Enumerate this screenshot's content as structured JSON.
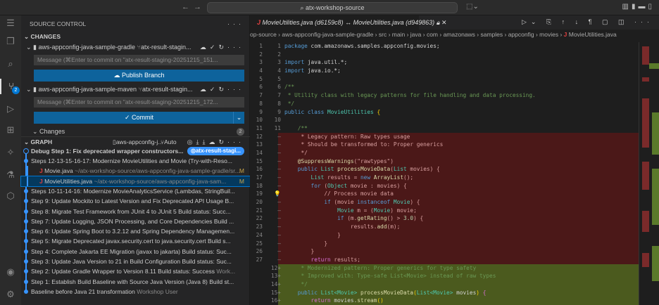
{
  "titlebar": {
    "search": "atx-workshop-source"
  },
  "activity": {
    "scm_badge": "2"
  },
  "sidebar": {
    "title": "SOURCE CONTROL",
    "changes_header": "CHANGES",
    "repos": [
      {
        "name": "aws-appconfig-java-sample-gradle",
        "branch": "atx-result-stagin...",
        "placeholder": "Message (⌘Enter to commit on \"atx-result-staging-20251215_151...",
        "button": "Publish Branch"
      },
      {
        "name": "aws-appconfig-java-sample-maven",
        "branch": "atx-result-stagin...",
        "placeholder": "Message (⌘Enter to commit on \"atx-result-staging-20251215_172...",
        "button": "Commit"
      }
    ],
    "changes_label": "Changes",
    "changes_count": "2",
    "graph": {
      "header": "GRAPH",
      "repo": "aws-appconfig-j...",
      "mode": "Auto",
      "head": {
        "message": "Debug Step 1: Fix deprecated wrapper constructors...",
        "branch": "atx-result-stagi..."
      },
      "commits": [
        {
          "message": "Steps 12-13-15-16-17: Modernize MovieUtilities and Movie (Try-with-Reso...",
          "author": ""
        },
        {
          "file": "Movie.java",
          "path": "~/atx-workshop-source/aws-appconfig-java-sample-gradle/sr...",
          "status": "M"
        },
        {
          "file": "MovieUtilities.java",
          "path": "~/atx-workshop-source/aws-appconfig-java-sam...",
          "status": "M"
        },
        {
          "message": "Steps 10-11-14-16: Modernize MovieAnalyticsService (Lambdas, StringBuil...",
          "author": ""
        },
        {
          "message": "Step 9: Update Mockito to Latest Version and Fix Deprecated API Usage B...",
          "author": ""
        },
        {
          "message": "Step 8: Migrate Test Framework from JUnit 4 to JUnit 5 Build status: Succ...",
          "author": ""
        },
        {
          "message": "Step 7: Update Logging, JSON Processing, and Core Dependencies Build ...",
          "author": ""
        },
        {
          "message": "Step 6: Update Spring Boot to 3.2.12 and Spring Dependency Managemen...",
          "author": ""
        },
        {
          "message": "Step 5: Migrate Deprecated javax.security.cert to java.security.cert Build s...",
          "author": ""
        },
        {
          "message": "Step 4: Complete Jakarta EE Migration (javax to jakarta) Build status: Suc...",
          "author": ""
        },
        {
          "message": "Step 3: Update Java Version to 21 in Build Configuration Build status: Suc...",
          "author": ""
        },
        {
          "message": "Step 2: Update Gradle Wrapper to Version 8.11 Build status: Success",
          "author": "Work..."
        },
        {
          "message": "Step 1: Establish Build Baseline with Source Java Version (Java 8) Build st...",
          "author": ""
        },
        {
          "message": "Baseline before Java 21 transformation",
          "author": "Workshop User"
        }
      ]
    }
  },
  "editor": {
    "tab": "MovieUtilities.java (d6159c8) ↔ MovieUtilities.java (d949863)",
    "breadcrumb": [
      "op-source",
      "aws-appconfig-java-sample-gradle",
      "src",
      "main",
      "java",
      "com",
      "amazonaws",
      "samples",
      "appconfig",
      "movies",
      "MovieUtilities.java"
    ],
    "lines": [
      {
        "o": "1",
        "n": "1",
        "k": "",
        "t": [
          [
            "kw",
            "package"
          ],
          [
            "pl",
            " com.amazonaws.samples.appconfig.movies;"
          ]
        ]
      },
      {
        "o": "2",
        "n": "2",
        "k": "",
        "t": []
      },
      {
        "o": "3",
        "n": "3",
        "k": "",
        "t": [
          [
            "kw",
            "import"
          ],
          [
            "pl",
            " java.util.*;"
          ]
        ]
      },
      {
        "o": "4",
        "n": "4",
        "k": "",
        "t": [
          [
            "kw",
            "import"
          ],
          [
            "pl",
            " java.io.*;"
          ]
        ]
      },
      {
        "o": "5",
        "n": "5",
        "k": "",
        "t": []
      },
      {
        "o": "6",
        "n": "6",
        "k": "",
        "t": [
          [
            "cm",
            "/**"
          ]
        ]
      },
      {
        "o": "7",
        "n": "7",
        "k": "",
        "t": [
          [
            "cm",
            " * Utility class with legacy patterns for file handling and data processing."
          ]
        ]
      },
      {
        "o": "8",
        "n": "8",
        "k": "",
        "t": [
          [
            "cm",
            " */"
          ]
        ]
      },
      {
        "o": "9",
        "n": "9",
        "k": "",
        "t": [
          [
            "kw",
            "public class "
          ],
          [
            "ty",
            "MovieUtilities"
          ],
          [
            "br",
            " {"
          ]
        ]
      },
      {
        "o": "10",
        "n": "10",
        "k": "",
        "t": []
      },
      {
        "o": "11",
        "n": "11",
        "k": "",
        "t": [
          [
            "cm",
            "    /**"
          ]
        ]
      },
      {
        "o": "12",
        "n": "—",
        "k": "del",
        "t": [
          [
            "cm",
            "     * Legacy pattern: Raw types usage"
          ]
        ]
      },
      {
        "o": "13",
        "n": "—",
        "k": "del",
        "t": [
          [
            "cm",
            "     * Should be transformed to: Proper generics"
          ]
        ]
      },
      {
        "o": "14",
        "n": "—",
        "k": "del",
        "t": [
          [
            "cm",
            "     */"
          ]
        ]
      },
      {
        "o": "15",
        "n": "—",
        "k": "del",
        "t": [
          [
            "fn",
            "    @SuppressWarnings"
          ],
          [
            "pl",
            "("
          ],
          [
            "st",
            "\"rawtypes\""
          ],
          [
            "pl",
            ")"
          ]
        ]
      },
      {
        "o": "16",
        "n": "—",
        "k": "del",
        "t": [
          [
            "kw",
            "    public "
          ],
          [
            "ty",
            "List"
          ],
          [
            "fn",
            " processMovieData"
          ],
          [
            "pl",
            "("
          ],
          [
            "ty",
            "List"
          ],
          [
            "pl",
            " movies) {"
          ]
        ]
      },
      {
        "o": "17",
        "n": "—",
        "k": "del",
        "t": [
          [
            "ty",
            "        List"
          ],
          [
            "pl",
            " results = "
          ],
          [
            "kw",
            "new"
          ],
          [
            "fn",
            " ArrayList"
          ],
          [
            "pl",
            "();"
          ]
        ]
      },
      {
        "o": "18",
        "n": "—",
        "k": "del",
        "t": [
          [
            "kw",
            "        for"
          ],
          [
            "pl",
            " ("
          ],
          [
            "ty",
            "Object"
          ],
          [
            "pl",
            " movie : movies) {"
          ]
        ]
      },
      {
        "o": "19",
        "n": "💡",
        "k": "del",
        "t": [
          [
            "cm",
            "            // Process movie data"
          ]
        ]
      },
      {
        "o": "20",
        "n": "—",
        "k": "del",
        "t": [
          [
            "kw",
            "            if"
          ],
          [
            "pl",
            " (movie "
          ],
          [
            "kw",
            "instanceof"
          ],
          [
            "ty",
            " Movie"
          ],
          [
            "pl",
            ") {"
          ]
        ]
      },
      {
        "o": "21",
        "n": "—",
        "k": "del",
        "t": [
          [
            "ty",
            "                Movie"
          ],
          [
            "pl",
            " m = ("
          ],
          [
            "ty",
            "Movie"
          ],
          [
            "pl",
            ") movie;"
          ]
        ]
      },
      {
        "o": "22",
        "n": "—",
        "k": "del",
        "t": [
          [
            "kw",
            "                if"
          ],
          [
            "pl",
            " (m."
          ],
          [
            "fn",
            "getRating"
          ],
          [
            "pl",
            "() > "
          ],
          [
            "nu",
            "3.0"
          ],
          [
            "pl",
            ") {"
          ]
        ]
      },
      {
        "o": "23",
        "n": "—",
        "k": "del",
        "t": [
          [
            "pl",
            "                    results."
          ],
          [
            "fn",
            "add"
          ],
          [
            "pl",
            "(m);"
          ]
        ]
      },
      {
        "o": "24",
        "n": "—",
        "k": "del",
        "t": [
          [
            "pl",
            "                }"
          ]
        ]
      },
      {
        "o": "25",
        "n": "—",
        "k": "del",
        "t": [
          [
            "pl",
            "            }"
          ]
        ]
      },
      {
        "o": "26",
        "n": "—",
        "k": "del",
        "t": [
          [
            "pl",
            "        }"
          ]
        ]
      },
      {
        "o": "27",
        "n": "—",
        "k": "del",
        "t": [
          [
            "pk",
            "        return"
          ],
          [
            "pl",
            " results;"
          ]
        ]
      },
      {
        "o": "",
        "n": "12+",
        "k": "add",
        "t": [
          [
            "cm",
            "     * Modernized pattern: Proper generics for type safety"
          ]
        ]
      },
      {
        "o": "",
        "n": "13+",
        "k": "add",
        "t": [
          [
            "cm",
            "     * Improved with: Type-safe List<Movie> instead of raw types"
          ]
        ]
      },
      {
        "o": "",
        "n": "14+",
        "k": "add",
        "t": [
          [
            "cm",
            "     */"
          ]
        ]
      },
      {
        "o": "",
        "n": "15+",
        "k": "add",
        "t": [
          [
            "kw",
            "    public "
          ],
          [
            "ty",
            "List<Movie>"
          ],
          [
            "fn",
            " processMovieData"
          ],
          [
            "br",
            "("
          ],
          [
            "ty",
            "List<Movie>"
          ],
          [
            "pl",
            " movies"
          ],
          [
            "br",
            ")"
          ],
          [
            "pk",
            " {"
          ]
        ]
      },
      {
        "o": "",
        "n": "16+",
        "k": "add",
        "t": [
          [
            "pk",
            "        return"
          ],
          [
            "pl",
            " movies."
          ],
          [
            "fn",
            "stream"
          ],
          [
            "br",
            "()"
          ]
        ]
      }
    ]
  }
}
